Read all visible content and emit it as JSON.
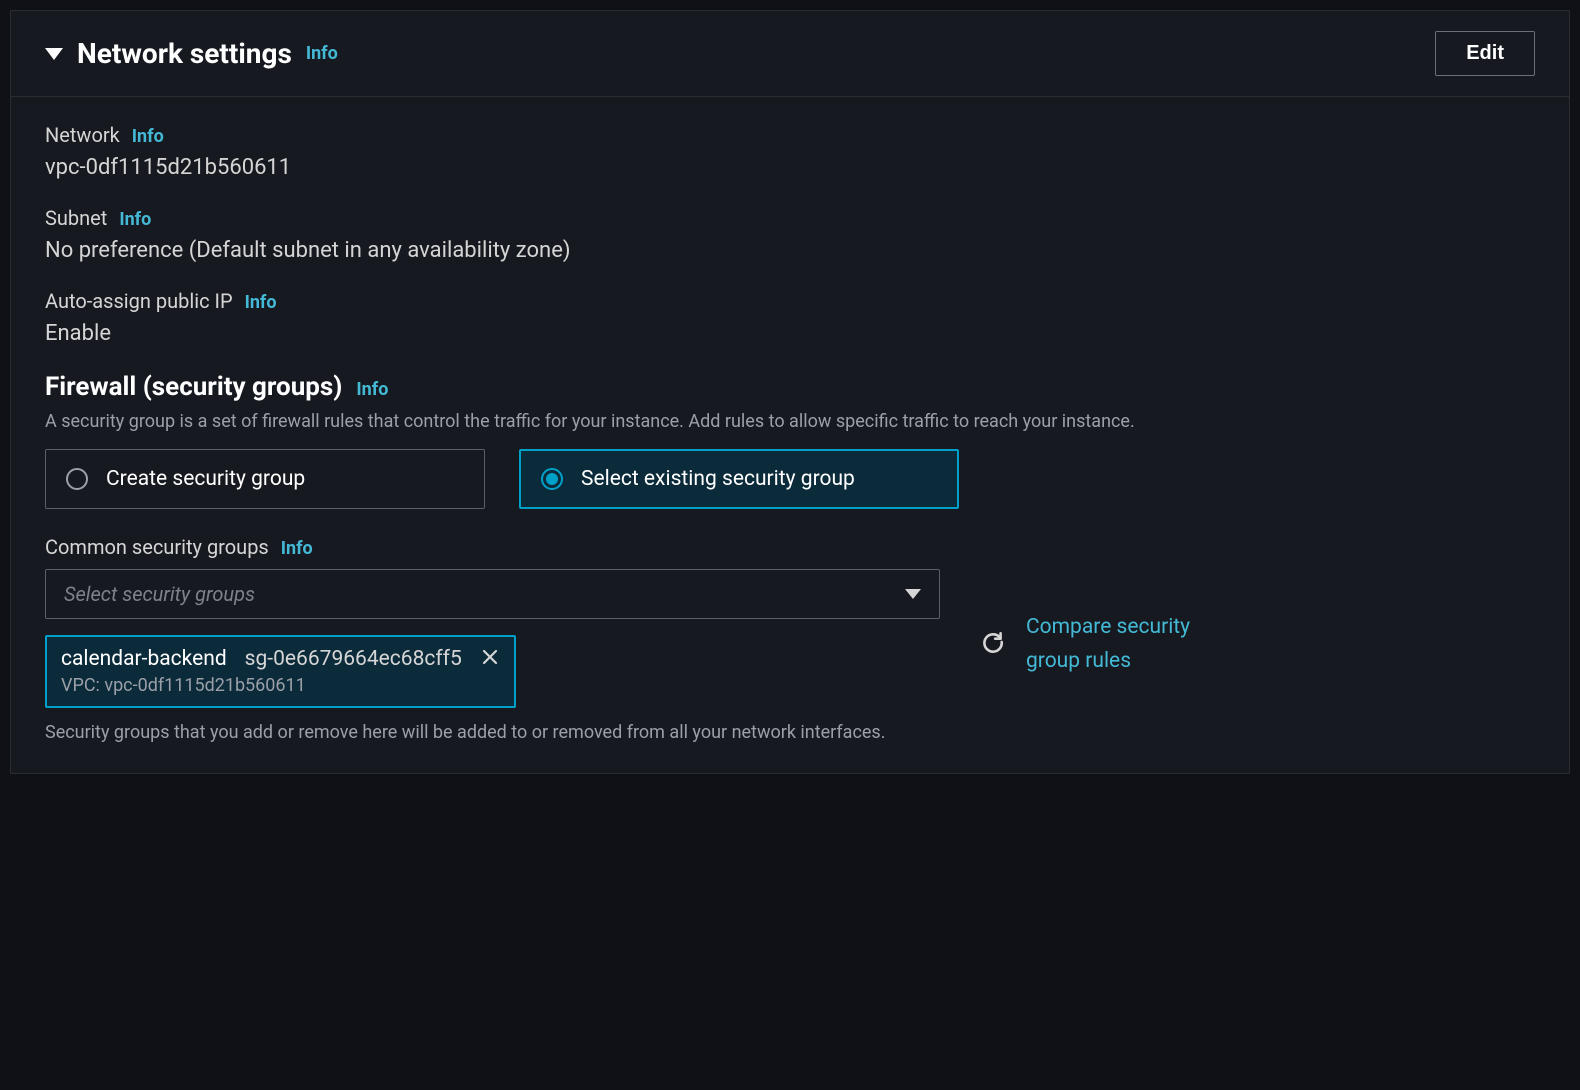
{
  "header": {
    "title": "Network settings",
    "info_label": "Info",
    "edit_label": "Edit"
  },
  "fields": {
    "network": {
      "label": "Network",
      "info": "Info",
      "value": "vpc-0df1115d21b560611"
    },
    "subnet": {
      "label": "Subnet",
      "info": "Info",
      "value": "No preference (Default subnet in any availability zone)"
    },
    "public_ip": {
      "label": "Auto-assign public IP",
      "info": "Info",
      "value": "Enable"
    }
  },
  "firewall": {
    "heading": "Firewall (security groups)",
    "info": "Info",
    "description": "A security group is a set of firewall rules that control the traffic for your instance. Add rules to allow specific traffic to reach your instance.",
    "options": {
      "create": "Create security group",
      "select": "Select existing security group"
    }
  },
  "common_sg": {
    "label": "Common security groups",
    "info": "Info",
    "placeholder": "Select security groups",
    "token": {
      "name": "calendar-backend",
      "id": "sg-0e6679664ec68cff5",
      "vpc": "VPC: vpc-0df1115d21b560611"
    },
    "note": "Security groups that you add or remove here will be added to or removed from all your network interfaces.",
    "compare": "Compare security group rules"
  }
}
